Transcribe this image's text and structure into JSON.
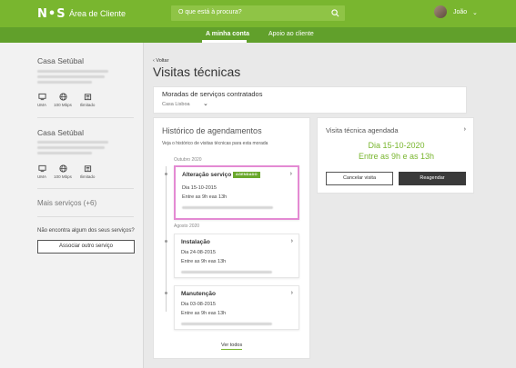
{
  "header": {
    "logo": "N•S",
    "app_title": "Área de Cliente",
    "search_placeholder": "O que está à procura?",
    "user_name": "João"
  },
  "subnav": {
    "tabs": [
      {
        "label": "A minha conta",
        "active": true
      },
      {
        "label": "Apoio ao cliente",
        "active": false
      }
    ]
  },
  "sidebar": {
    "houses": [
      {
        "name": "Casa Setúbal",
        "services": [
          {
            "icon": "tv-icon",
            "label": "UMA"
          },
          {
            "icon": "globe-icon",
            "label": "100 Mbps"
          },
          {
            "icon": "phone-icon",
            "label": "Ilimitado"
          }
        ]
      },
      {
        "name": "Casa Setúbal",
        "services": [
          {
            "icon": "tv-icon",
            "label": "UMA"
          },
          {
            "icon": "globe-icon",
            "label": "100 Mbps"
          },
          {
            "icon": "phone-icon",
            "label": "Ilimitado"
          }
        ]
      }
    ],
    "more_services": "Mais serviços (+6)",
    "not_found_text": "Não encontra algum dos seus serviços?",
    "associate_button": "Associar outro serviço"
  },
  "main": {
    "back_label": "Voltar",
    "title": "Visitas técnicas",
    "moradas": {
      "title": "Moradas de serviços contratados",
      "value": "Casa Lisboa"
    },
    "history": {
      "title": "Histórico de agendamentos",
      "description": "Veja o histórico de visitas técnicas para esta morada",
      "groups": [
        {
          "month": "Outubro 2020",
          "items": [
            {
              "title": "Alteração serviço",
              "badge": "AGENDADO",
              "date": "Dia 15-10-2015",
              "time": "Entre as 9h eas 13h"
            }
          ]
        },
        {
          "month": "Agosto 2020",
          "items": [
            {
              "title": "Instalação",
              "date": "Dia 24-08-2015",
              "time": "Entre as 9h eas 13h"
            },
            {
              "title": "Manutenção",
              "date": "Dia 03-08-2015",
              "time": "Entre as 9h eas 13h"
            }
          ]
        }
      ],
      "see_all": "Ver todos"
    },
    "scheduled_visit": {
      "title": "Visita técnica agendada",
      "day": "Dia 15-10-2020",
      "time": "Entre as 9h e as 13h",
      "cancel_label": "Cancelar visita",
      "reschedule_label": "Reagendar"
    }
  },
  "colors": {
    "brand_green": "#79b62f",
    "subnav_green": "#61a02b",
    "badge_green": "#6aa82c",
    "highlight_pink": "#e48ad3"
  }
}
